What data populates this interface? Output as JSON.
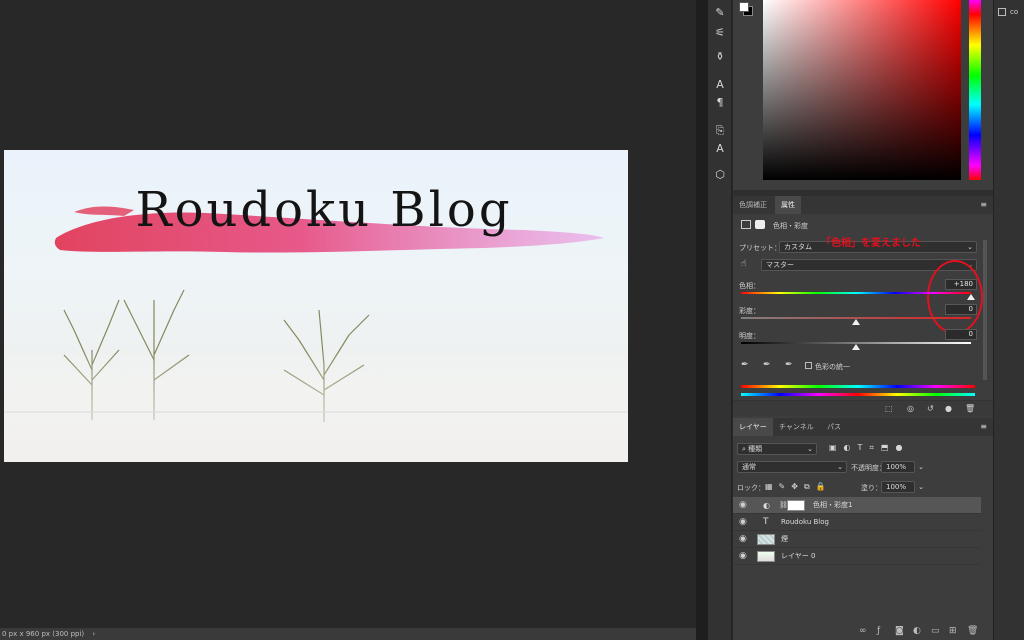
{
  "status": {
    "text": "0 px x 960 px (300 ppi)",
    "arrow": "›"
  },
  "document": {
    "title": "Roudoku Blog"
  },
  "color_picker": {
    "swatch_fg": "#ffffff",
    "swatch_bg": "#000000",
    "hue_color": "#ff0000"
  },
  "props_tabs": {
    "adjust": "色調補正",
    "properties": "属性"
  },
  "props": {
    "header_label": "色相・彩度",
    "preset_label": "プリセット：",
    "preset_value": "カスタム",
    "channel_value": "マスター",
    "hue_label": "色相：",
    "hue_value": "+180",
    "sat_label": "彩度：",
    "sat_value": "0",
    "light_label": "明度：",
    "light_value": "0",
    "colorize_label": "色彩の統一",
    "annotation": "「色相」を変えました",
    "hue_fraction": 1.0,
    "sat_fraction": 0.5,
    "light_fraction": 0.5
  },
  "layers_tabs": {
    "layers": "レイヤー",
    "channels": "チャンネル",
    "paths": "パス"
  },
  "layers_toolbar": {
    "kind_value": "種類",
    "blend_value": "通常",
    "opacity_label": "不透明度：",
    "opacity_value": "100%",
    "lock_label": "ロック：",
    "fill_label": "塗り：",
    "fill_value": "100%"
  },
  "layers": [
    {
      "name": "色相・彩度1",
      "type": "adjustment"
    },
    {
      "name": "Roudoku Blog",
      "type": "text"
    },
    {
      "name": "煙",
      "type": "image"
    },
    {
      "name": "レイヤー 0",
      "type": "image"
    }
  ],
  "far_right": {
    "label": "co"
  }
}
